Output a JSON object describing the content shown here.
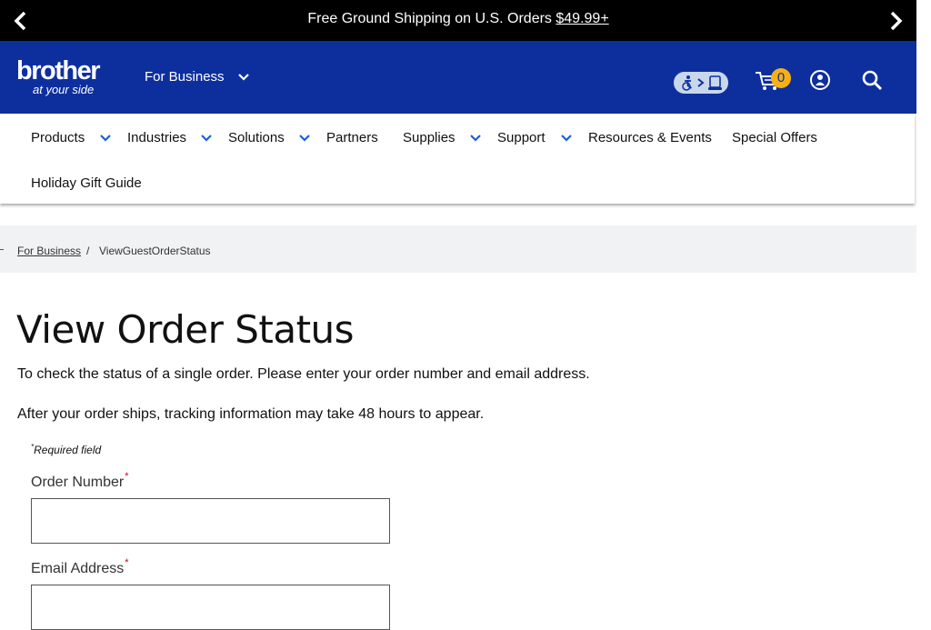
{
  "promo": {
    "text": "Free Ground Shipping on U.S. Orders ",
    "price": "$49.99+"
  },
  "header": {
    "logo_brand": "brother",
    "logo_tagline": "at your side",
    "segment": "For Business",
    "cart_count": "0"
  },
  "nav": {
    "items": [
      {
        "label": "Products"
      },
      {
        "label": "Industries"
      },
      {
        "label": "Solutions"
      },
      {
        "label": "Partners"
      },
      {
        "label": "Supplies"
      },
      {
        "label": "Support"
      },
      {
        "label": "Resources & Events"
      },
      {
        "label": "Special Offers"
      },
      {
        "label": "Holiday Gift Guide"
      }
    ]
  },
  "breadcrumb": {
    "home": "For Business",
    "separator": "/",
    "current": "ViewGuestOrderStatus"
  },
  "main": {
    "title": "View Order Status",
    "intro": "To check the status of a single order. Please enter your order number and email address.",
    "note": "After your order ships, tracking information may take 48 hours to appear.",
    "required_mark": "*",
    "required_text": "Required field",
    "order_label": "Order Number",
    "order_value": "",
    "email_label": "Email Address",
    "email_value": ""
  },
  "colors": {
    "header_bg": "#0d2f9e",
    "accent": "#1a5fd6",
    "badge": "#f5b014",
    "required": "#d0021b"
  },
  "icons": [
    "chevron-left-icon",
    "chevron-right-icon",
    "chevron-down-icon",
    "accessibility-icon",
    "cart-icon",
    "user-icon",
    "search-icon"
  ]
}
